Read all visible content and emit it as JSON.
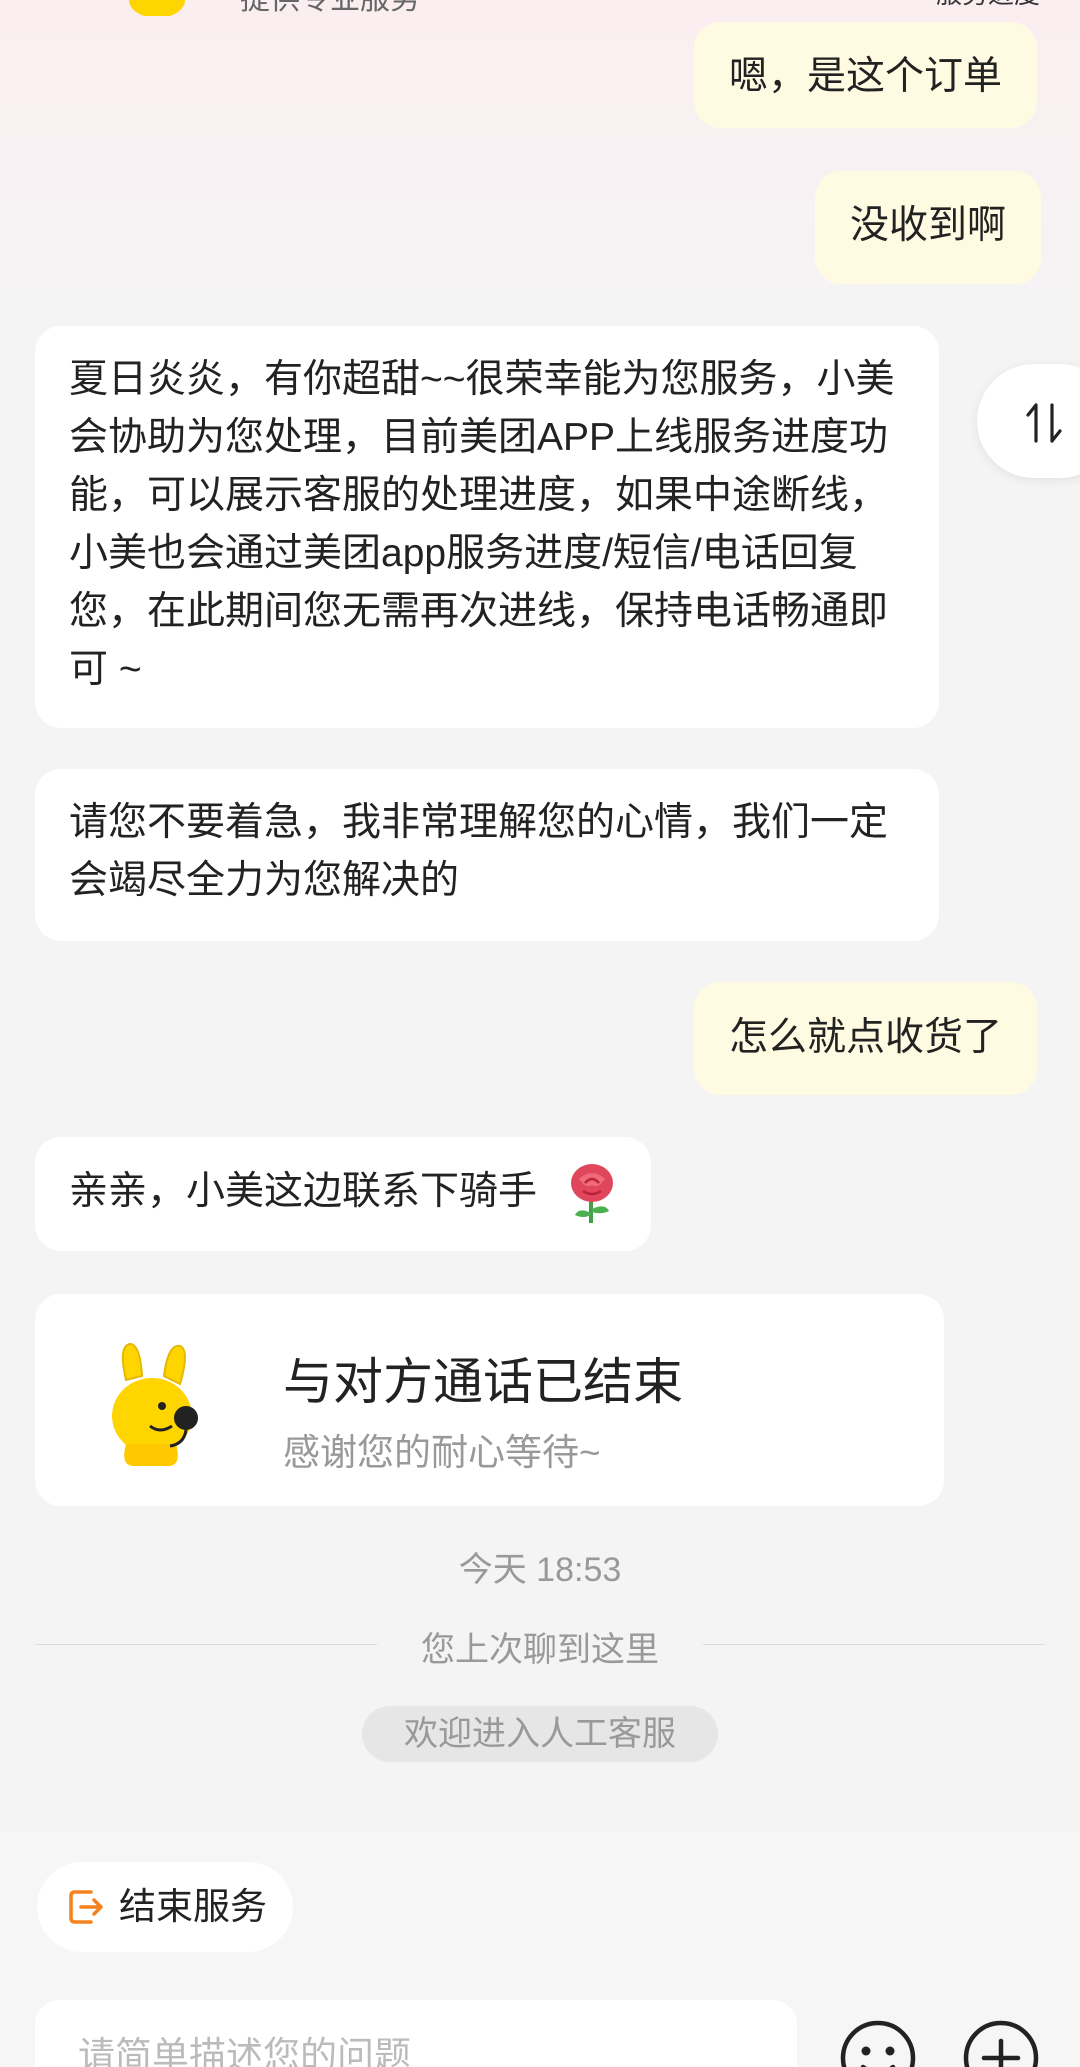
{
  "header": {
    "subtitle": "提供专业服务",
    "progress_label": "服务进度"
  },
  "messages": [
    {
      "side": "right",
      "text": "嗯，是这个订单"
    },
    {
      "side": "right",
      "text": "没收到啊"
    },
    {
      "side": "left",
      "text": "夏日炎炎，有你超甜~~很荣幸能为您服务，小美会协助为您处理，目前美团APP上线服务进度功能，可以展示客服的处理进度，如果中途断线，小美也会通过美团app服务进度/短信/电话回复您，在此期间您无需再次进线，保持电话畅通即可 ~"
    },
    {
      "side": "left",
      "text": "请您不要着急，我非常理解您的心情，我们一定会竭尽全力为您解决的"
    },
    {
      "side": "right",
      "text": "怎么就点收货了"
    },
    {
      "side": "left",
      "text": "亲亲，小美这边联系下骑手"
    }
  ],
  "call_card": {
    "title": "与对方通话已结束",
    "subtitle": "感谢您的耐心等待~"
  },
  "timestamp": "今天 18:53",
  "last_read_divider": "您上次聊到这里",
  "system_notice": "欢迎进入人工客服",
  "footer": {
    "end_service_label": "结束服务",
    "input_placeholder": "请简单描述您的问题"
  },
  "icons": {
    "float": "sort-arrows-icon",
    "end_service": "exit-icon",
    "emoji": "emoji-icon",
    "plus": "plus-icon",
    "rose": "rose-icon",
    "mascot": "mascot-headset-icon"
  },
  "colors": {
    "user_bubble": "#fffbe2",
    "agent_bubble": "#ffffff",
    "accent_orange": "#f5821f",
    "mascot_yellow": "#ffd500"
  }
}
